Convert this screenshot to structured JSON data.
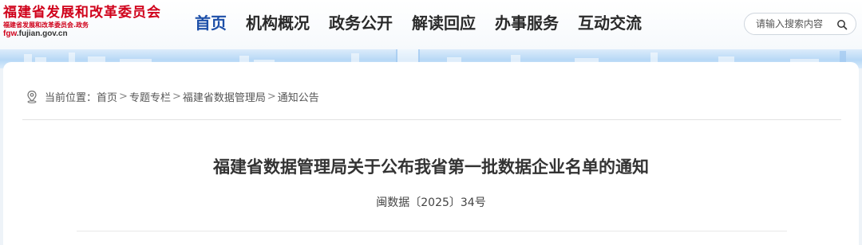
{
  "site": {
    "name": "福建省发展和改革委员会",
    "subname": "福建省发展和改革委员会.政务",
    "domain_prefix": "fgw",
    "domain_rest": ".fujian.gov.cn"
  },
  "nav": {
    "items": [
      {
        "label": "首页",
        "active": true
      },
      {
        "label": "机构概况"
      },
      {
        "label": "政务公开"
      },
      {
        "label": "解读回应"
      },
      {
        "label": "办事服务"
      },
      {
        "label": "互动交流"
      }
    ]
  },
  "search": {
    "placeholder": "请输入搜索内容"
  },
  "breadcrumb": {
    "prefix": "当前位置：",
    "items": [
      "首页",
      "专题专栏",
      "福建省数据管理局",
      "通知公告"
    ],
    "separator": ">"
  },
  "article": {
    "title": "福建省数据管理局关于公布我省第一批数据企业名单的通知",
    "doc_number": "闽数据〔2025〕34号"
  },
  "colors": {
    "brand_red": "#d0021b",
    "nav_active": "#1d4fa8"
  }
}
